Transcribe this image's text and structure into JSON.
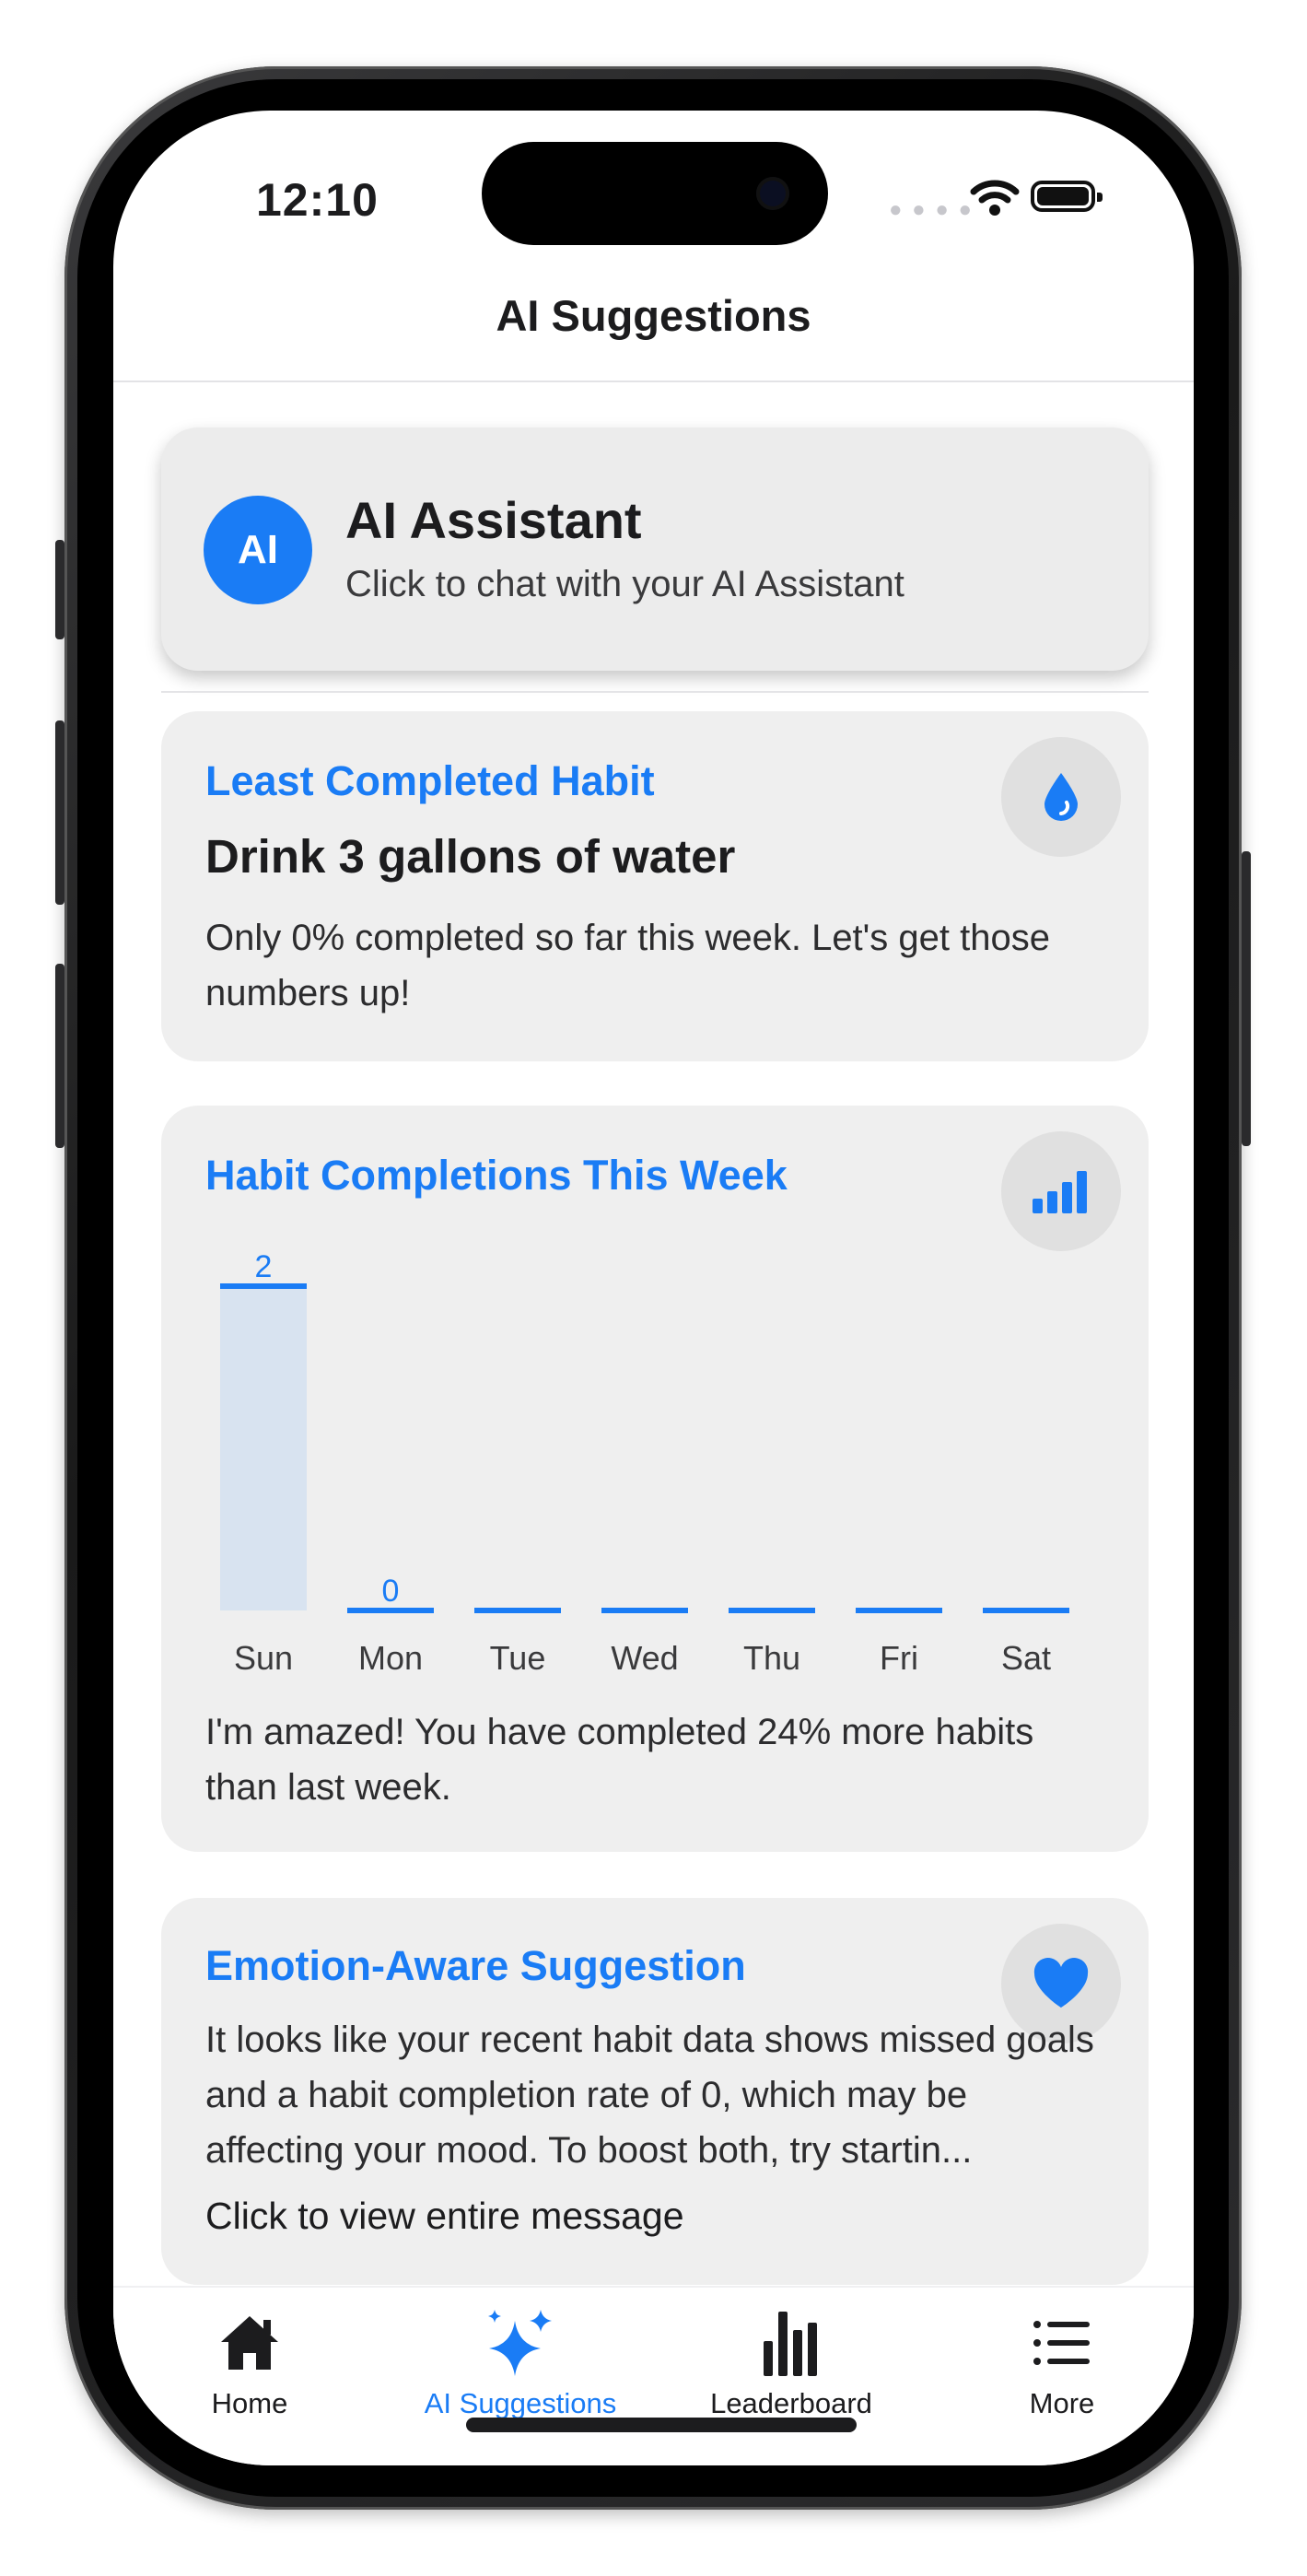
{
  "status_bar": {
    "time": "12:10"
  },
  "header": {
    "title": "AI Suggestions"
  },
  "assistant": {
    "avatar_text": "AI",
    "title": "AI Assistant",
    "subtitle": "Click to chat with your AI Assistant"
  },
  "least_completed": {
    "heading": "Least Completed Habit",
    "habit": "Drink 3 gallons of water",
    "message": "Only 0% completed so far this week. Let's get those numbers up!",
    "icon": "water-drop-icon"
  },
  "completions": {
    "heading": "Habit Completions This Week",
    "icon": "bar-chart-icon",
    "message": "I'm amazed! You have completed 24% more habits than last week."
  },
  "chart_data": {
    "type": "bar",
    "title": "Habit Completions This Week",
    "categories": [
      "Sun",
      "Mon",
      "Tue",
      "Wed",
      "Thu",
      "Fri",
      "Sat"
    ],
    "values": [
      2,
      0,
      0,
      0,
      0,
      0,
      0
    ],
    "data_labels": [
      "2",
      "0",
      "",
      "",
      "",
      "",
      ""
    ],
    "ylim": [
      0,
      2
    ],
    "grid": false,
    "bar_color": "#1a7cf5",
    "bar_fill": "#d8e3f0"
  },
  "emotion": {
    "heading": "Emotion-Aware Suggestion",
    "icon": "heart-icon",
    "message": "It looks like your recent habit data shows missed goals and a habit completion rate of 0, which may be affecting your mood. To boost both, try startin...",
    "link": "Click to view entire message"
  },
  "tabs": [
    {
      "label": "Home",
      "icon": "home-icon"
    },
    {
      "label": "AI Suggestions",
      "icon": "sparkles-icon"
    },
    {
      "label": "Leaderboard",
      "icon": "leaderboard-icon"
    },
    {
      "label": "More",
      "icon": "list-icon"
    }
  ],
  "colors": {
    "accent": "#1a7cf5",
    "card": "#efefef",
    "text": "#1c1c1e"
  }
}
